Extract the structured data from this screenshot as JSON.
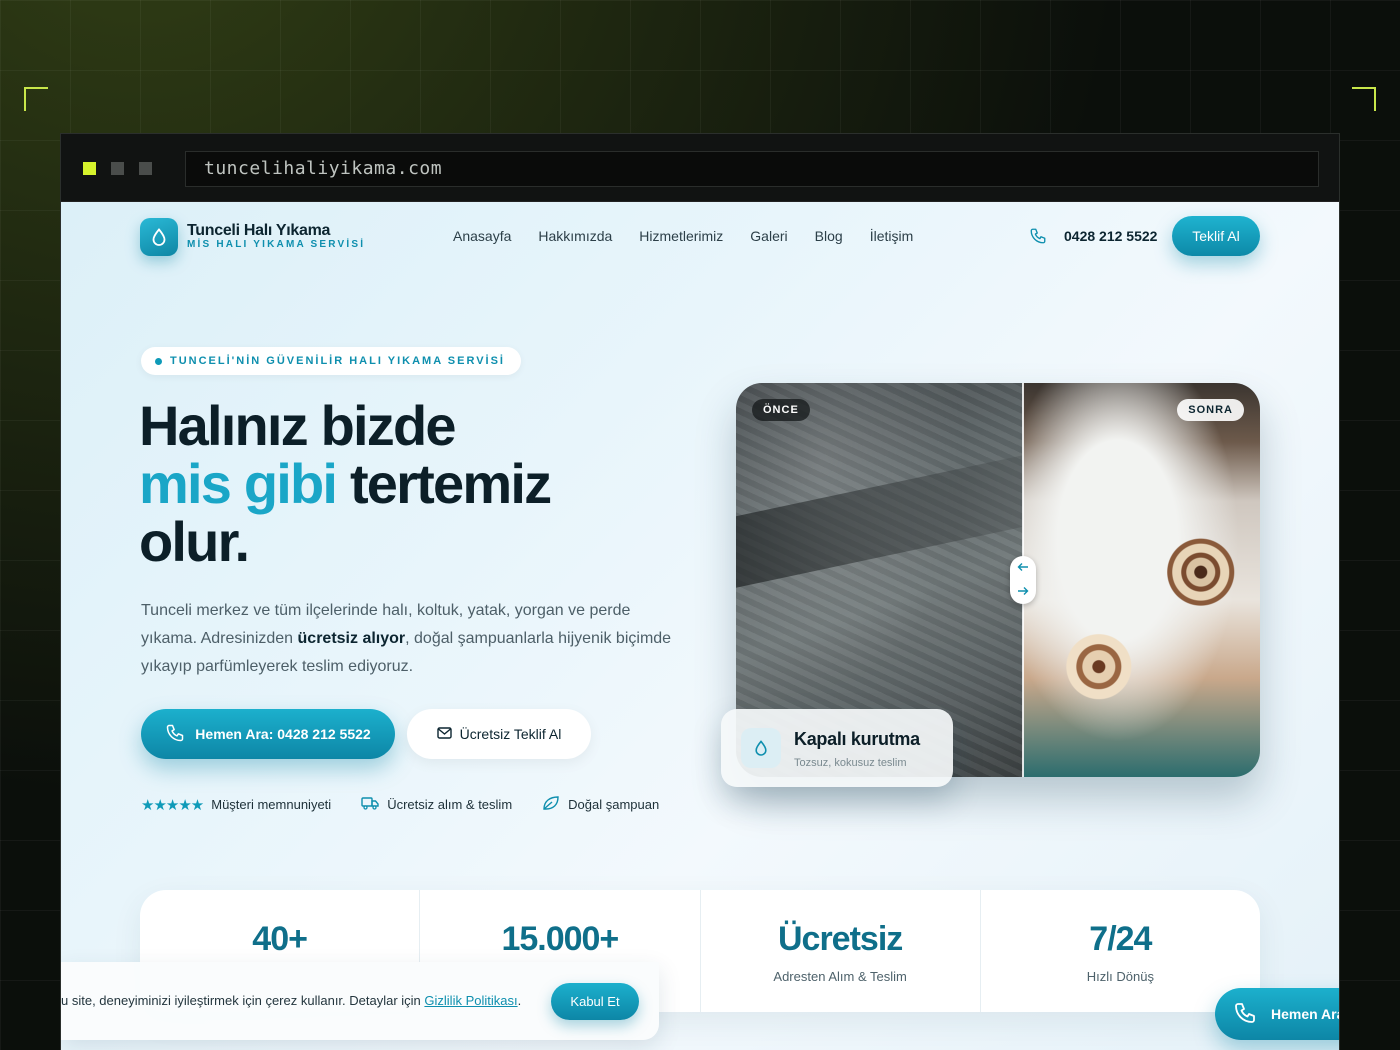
{
  "browser": {
    "url": "tuncelihaliyikama.com"
  },
  "brand": {
    "name": "Tunceli Halı Yıkama",
    "subtitle": "MİS HALI YIKAMA SERVİSİ"
  },
  "nav": {
    "items": [
      "Anasayfa",
      "Hakkımızda",
      "Hizmetlerimiz",
      "Galeri",
      "Blog",
      "İletişim"
    ],
    "phone": "0428 212 5522",
    "cta": "Teklif Al"
  },
  "hero": {
    "badge": "TUNCELİ'NİN GÜVENİLİR HALI YIKAMA SERVİSİ",
    "title_line1": "Halınız bizde",
    "title_accent": "mis gibi",
    "title_line2_rest": " tertemiz",
    "title_line3": "olur.",
    "desc_before": "Tunceli merkez ve tüm ilçelerinde halı, koltuk, yatak, yorgan ve perde yıkama. Adresinizden ",
    "desc_bold": "ücretsiz alıyor",
    "desc_after": ", doğal şampuanlarla hijyenik biçimde yıkayıp parfümleyerek teslim ediyoruz.",
    "btn_call": "Hemen Ara: 0428 212 5522",
    "btn_quote": "Ücretsiz Teklif Al",
    "features": {
      "stars": "★★★★★",
      "rating": "Müşteri memnuniyeti",
      "pickup": "Ücretsiz alım & teslim",
      "shampoo": "Doğal şampuan"
    }
  },
  "compare": {
    "before_label": "ÖNCE",
    "after_label": "SONRA",
    "card_title": "Kapalı kurutma",
    "card_sub": "Tozsuz, kokusuz teslim"
  },
  "stats": [
    {
      "value": "40+",
      "label": ""
    },
    {
      "value": "15.000+",
      "label": ""
    },
    {
      "value": "Ücretsiz",
      "label": "Adresten Alım & Teslim"
    },
    {
      "value": "7/24",
      "label": "Hızlı Dönüş"
    }
  ],
  "cookie": {
    "text": "u site, deneyiminizi iyileştirmek için çerez kullanır. Detaylar için ",
    "link": "Gizlilik Politikası",
    "dot": ".",
    "accept": "Kabul Et"
  },
  "floating_call": {
    "label": "Hemen Ara"
  },
  "colors": {
    "accent": "#1aa6c7",
    "primary_dark": "#0c1f28",
    "stat_number": "#0f6f8a",
    "browser_dot_active": "#d6f32c"
  }
}
